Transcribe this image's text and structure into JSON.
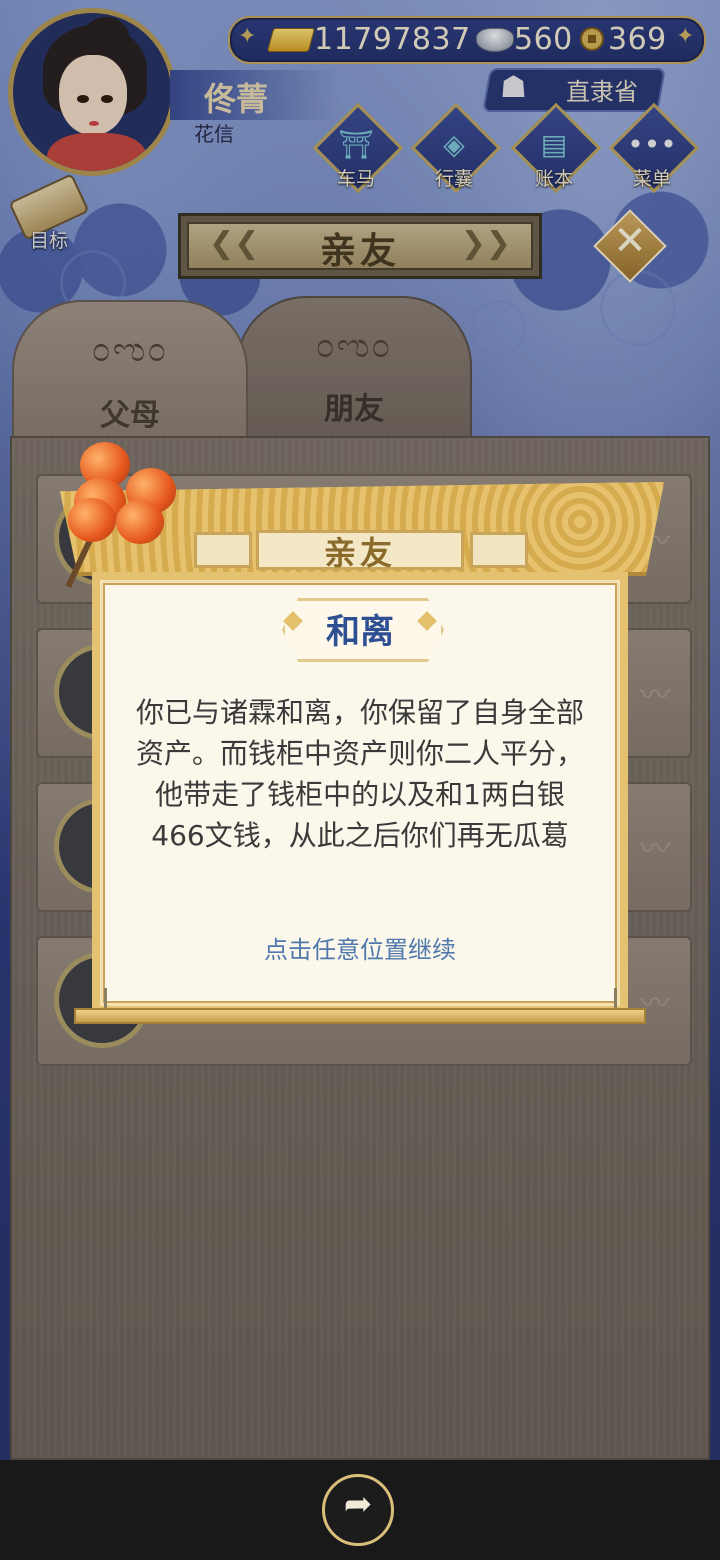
{
  "hud": {
    "gold": "11797837",
    "silver": "560",
    "coins": "369",
    "player_name": "佟菁",
    "player_title": "花信",
    "location": "直隶省"
  },
  "menu": [
    {
      "label": "车马",
      "icon": "carriage-icon"
    },
    {
      "label": "行囊",
      "icon": "bag-icon"
    },
    {
      "label": "账本",
      "icon": "ledger-icon"
    },
    {
      "label": "菜单",
      "icon": "menu-dots-icon"
    }
  ],
  "goal_label": "目标",
  "screen_title": "亲友",
  "tabs": [
    {
      "label": "父母",
      "active": true
    },
    {
      "label": "朋友",
      "active": false
    }
  ],
  "dialog": {
    "scroll_title": "亲友",
    "heading": "和离",
    "message": "你已与诸霖和离，你保留了自身全部资产。而钱柜中资产则你二人平分，他带走了钱柜中的以及和1两白银466文钱，从此之后你们再无瓜葛",
    "continue_hint": "点击任意位置继续"
  },
  "icons": {
    "gold": "gold-ingot-icon",
    "silver": "silver-ingot-icon",
    "coin": "copper-coin-icon",
    "share": "share-icon",
    "close": "close-icon"
  },
  "colors": {
    "accent_gold": "#c8a95e",
    "heading_blue": "#2f4f93",
    "link_blue": "#4f78ad"
  }
}
